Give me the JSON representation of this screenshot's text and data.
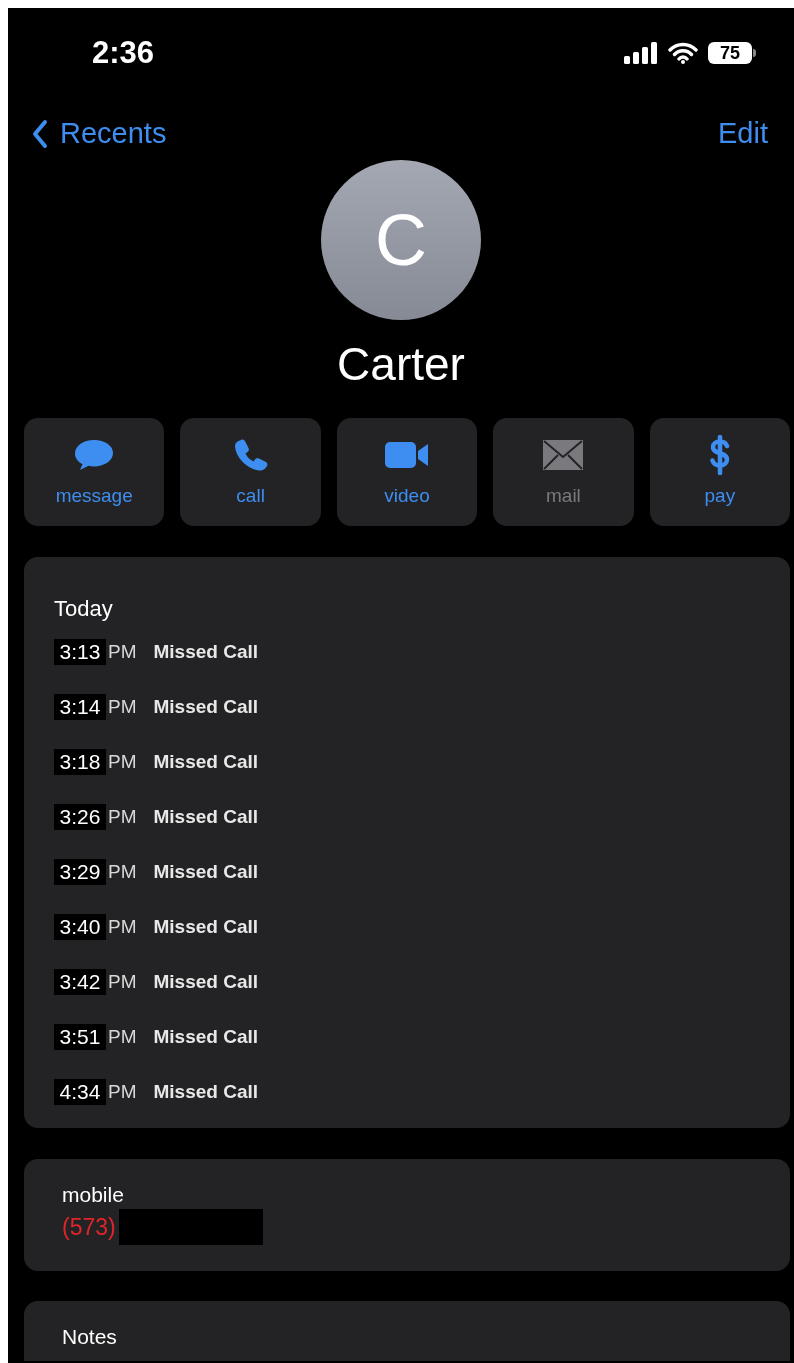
{
  "status_bar": {
    "time": "2:36",
    "battery": "75"
  },
  "nav": {
    "back": "Recents",
    "edit": "Edit"
  },
  "contact": {
    "initial": "C",
    "name": "Carter"
  },
  "actions": [
    {
      "kind": "message",
      "label": "message",
      "disabled": false
    },
    {
      "kind": "call",
      "label": "call",
      "disabled": false
    },
    {
      "kind": "video",
      "label": "video",
      "disabled": false
    },
    {
      "kind": "mail",
      "label": "mail",
      "disabled": true
    },
    {
      "kind": "pay",
      "label": "pay",
      "disabled": false
    }
  ],
  "history": {
    "heading": "Today",
    "calls": [
      {
        "time": "3:13",
        "period": "PM",
        "type": "Missed Call"
      },
      {
        "time": "3:14",
        "period": "PM",
        "type": "Missed Call"
      },
      {
        "time": "3:18",
        "period": "PM",
        "type": "Missed Call"
      },
      {
        "time": "3:26",
        "period": "PM",
        "type": "Missed Call"
      },
      {
        "time": "3:29",
        "period": "PM",
        "type": "Missed Call"
      },
      {
        "time": "3:40",
        "period": "PM",
        "type": "Missed Call"
      },
      {
        "time": "3:42",
        "period": "PM",
        "type": "Missed Call"
      },
      {
        "time": "3:51",
        "period": "PM",
        "type": "Missed Call"
      },
      {
        "time": "4:34",
        "period": "PM",
        "type": "Missed Call"
      }
    ]
  },
  "phone": {
    "label": "mobile",
    "area_code": "(573)"
  },
  "notes": {
    "label": "Notes"
  }
}
